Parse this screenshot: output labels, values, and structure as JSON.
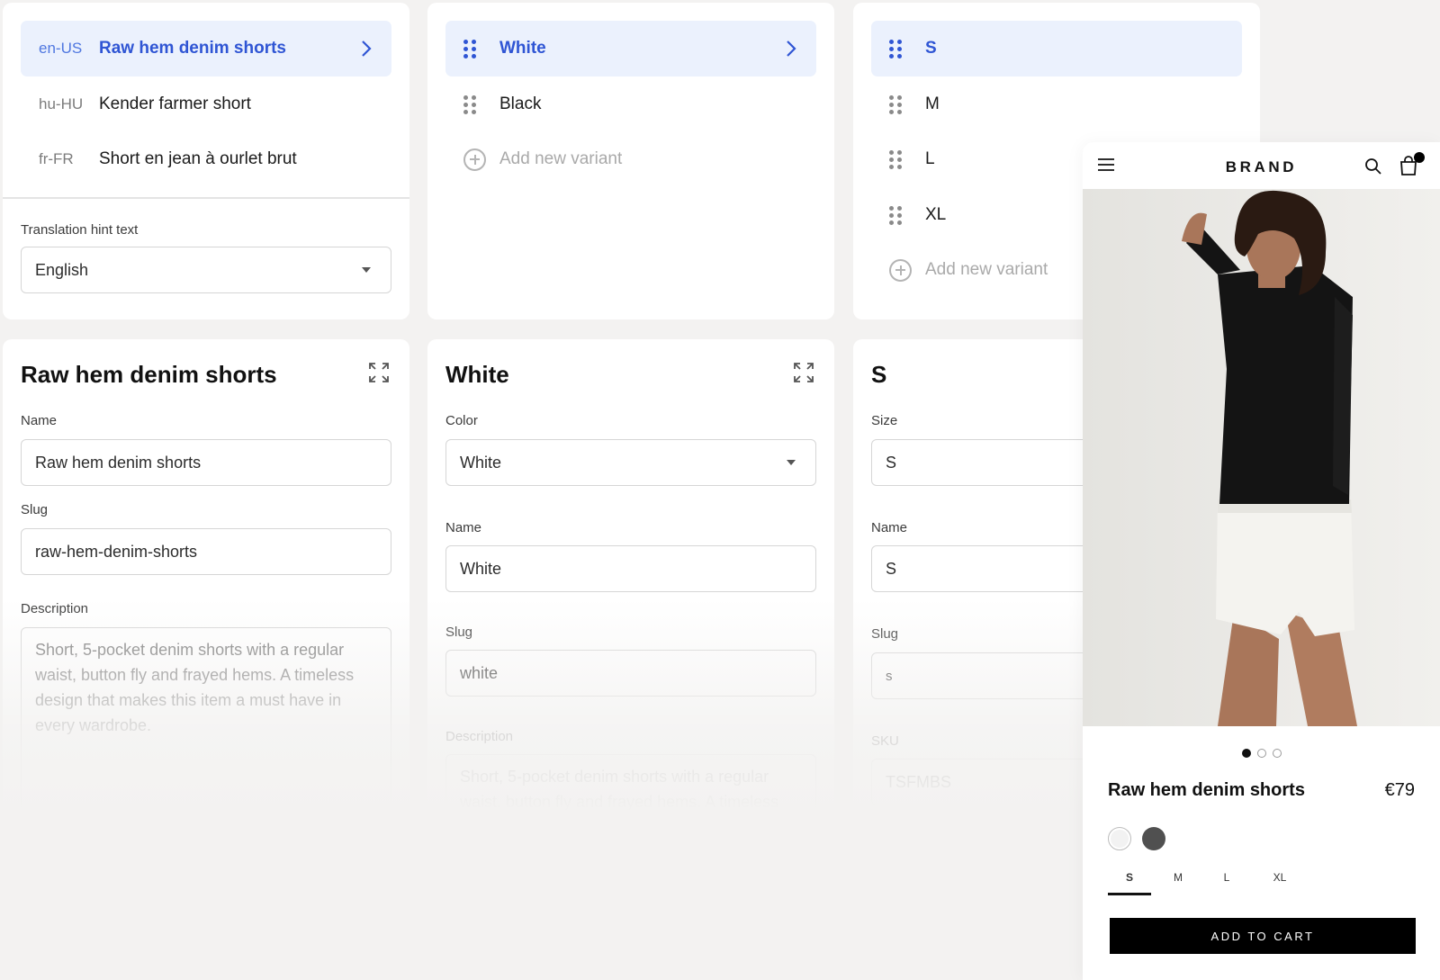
{
  "translations": {
    "items": [
      {
        "locale": "en-US",
        "name": "Raw hem denim shorts"
      },
      {
        "locale": "hu-HU",
        "name": "Kender farmer short"
      },
      {
        "locale": "fr-FR",
        "name": "Short en jean à ourlet brut"
      }
    ],
    "hint_label": "Translation hint text",
    "hint_value": "English"
  },
  "colors": {
    "items": [
      "White",
      "Black"
    ],
    "add_label": "Add new variant"
  },
  "sizes": {
    "items": [
      "S",
      "M",
      "L",
      "XL"
    ],
    "add_label": "Add new variant"
  },
  "product_form": {
    "title": "Raw hem denim shorts",
    "name_label": "Name",
    "name_value": "Raw hem denim shorts",
    "slug_label": "Slug",
    "slug_value": "raw-hem-denim-shorts",
    "description_label": "Description",
    "description_value": "Short, 5-pocket denim shorts with a regular waist, button fly and frayed hems. A timeless design that makes this item a must have in every wardrobe."
  },
  "color_form": {
    "title": "White",
    "color_label": "Color",
    "color_value": "White",
    "name_label": "Name",
    "name_value": "White",
    "slug_label": "Slug",
    "slug_value": "white",
    "description_label": "Description",
    "description_value": "Short, 5-pocket denim shorts with a regular waist, button fly and frayed hems. A timeless"
  },
  "size_form": {
    "title": "S",
    "size_label": "Size",
    "size_value": "S",
    "name_label": "Name",
    "name_value": "S",
    "slug_label": "Slug",
    "slug_value": "s",
    "sku_label": "SKU",
    "sku_value": "TSFMBS"
  },
  "preview": {
    "brand": "BRAND",
    "product_name": "Raw hem denim shorts",
    "price": "€79",
    "sizes": [
      "S",
      "M",
      "L",
      "XL"
    ],
    "selected_size": "S",
    "swatches": [
      "#f2f2f2",
      "#505050"
    ],
    "carousel_active": 1,
    "carousel_count": 3,
    "cart_label": "ADD TO CART",
    "cart_badge_color": "#000000"
  },
  "theme": {
    "accent": "#2f55d4",
    "accent_bg": "#ebf1fd",
    "page_bg": "#f3f2f1"
  }
}
